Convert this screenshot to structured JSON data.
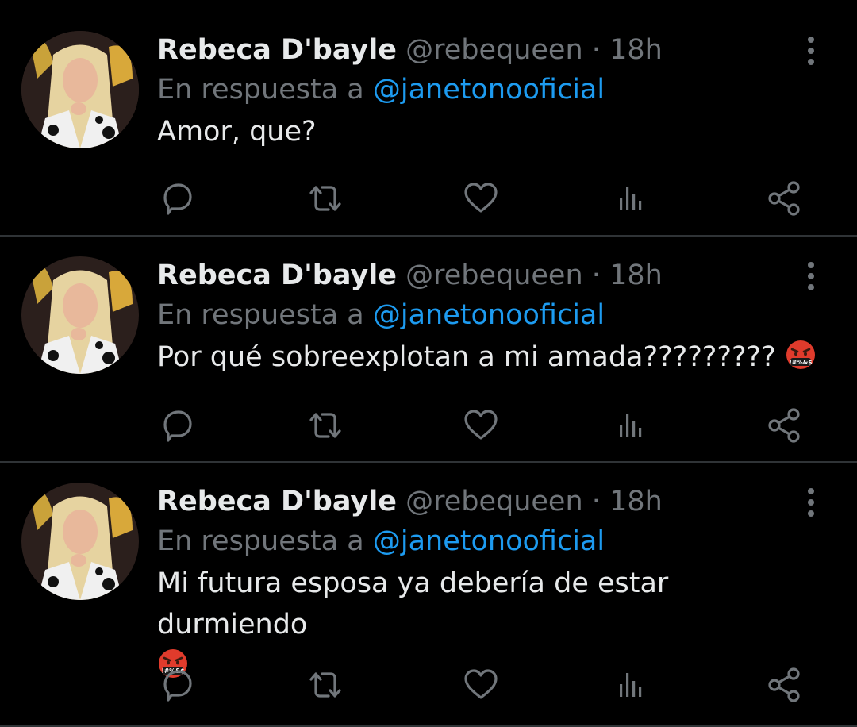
{
  "tweets": [
    {
      "name": "Rebeca D'bayle",
      "handle": "@rebequeen",
      "separator": "·",
      "time": "18h",
      "reply_prefix": "En respuesta a",
      "reply_to": "@janetonooficial",
      "text": "Amor, que?",
      "emoji": ""
    },
    {
      "name": "Rebeca D'bayle",
      "handle": "@rebequeen",
      "separator": "·",
      "time": "18h",
      "reply_prefix": "En respuesta a",
      "reply_to": "@janetonooficial",
      "text": "Por qué sobreexplotan a mi amada?????????",
      "emoji": "face-with-symbols-on-mouth"
    },
    {
      "name": "Rebeca D'bayle",
      "handle": "@rebequeen",
      "separator": "·",
      "time": "18h",
      "reply_prefix": "En respuesta a",
      "reply_to": "@janetonooficial",
      "text": "Mi futura esposa ya debería de estar durmiendo",
      "emoji": "face-with-symbols-on-mouth"
    }
  ],
  "icons": {
    "more": "more-vertical-icon",
    "reply": "reply-icon",
    "retweet": "retweet-icon",
    "like": "heart-icon",
    "views": "views-icon",
    "share": "share-icon"
  },
  "colors": {
    "background": "#000000",
    "text": "#e7e9ea",
    "secondary": "#71767b",
    "link": "#1d9bf0",
    "divider": "#2f3336",
    "icon": "#71767b"
  }
}
